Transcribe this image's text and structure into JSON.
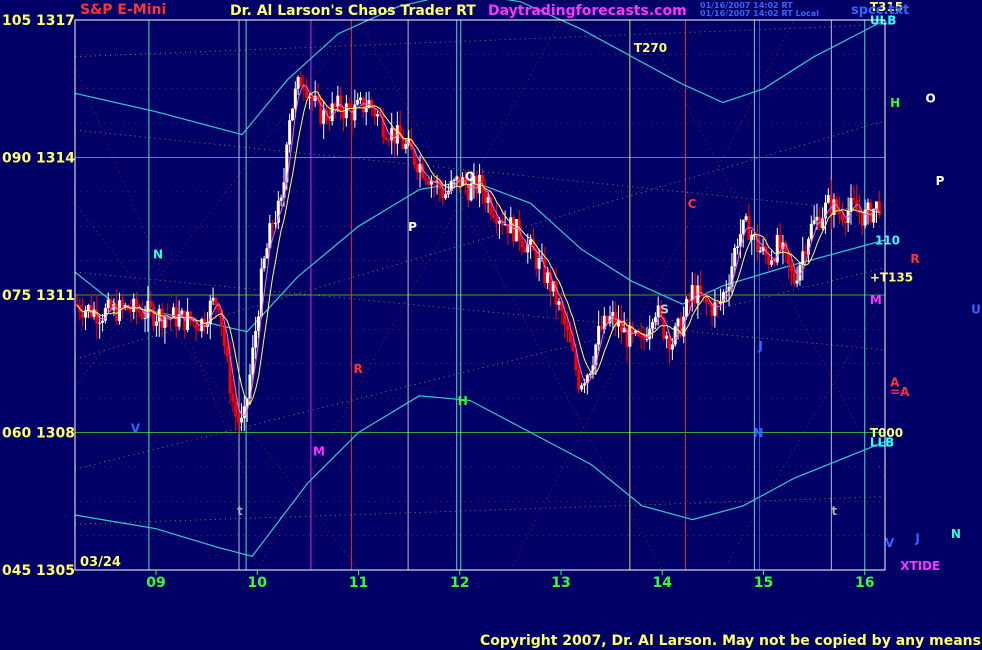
{
  "header": {
    "symbol": "S&P E-Mini",
    "title": "Dr. Al Larson's Chaos Trader RT",
    "website": "Daytradingforecasts.com",
    "stamp_line1": "01/16/2007 14:02 RT",
    "stamp_line2": "01/16/2007 14:02 RT Local",
    "file": "spcc.txt"
  },
  "footer": {
    "copyright": "Copyright 2007, Dr. Al Larson.  May not be copied by any means."
  },
  "colors": {
    "background": "#000066",
    "frame": "#ffffff",
    "up_bar": "#ffffff",
    "down_bar": "#ff0000",
    "envelope": "#33cccc",
    "grid_green": "#33aa33",
    "yellow_text": "#ffff00",
    "red_text": "#ff0000",
    "magenta_text": "#ff33ff",
    "green_text": "#33ff33",
    "cyan_text": "#33ffff"
  },
  "chart_data": {
    "type": "candlestick",
    "date_label": "03/24",
    "x_tick_labels": [
      "09",
      "10",
      "11",
      "12",
      "13",
      "14",
      "15",
      "16"
    ],
    "x_tick_values": [
      9,
      10,
      11,
      12,
      13,
      14,
      15,
      16
    ],
    "xlim": [
      8.2,
      16.2
    ],
    "y_ticks": [
      {
        "left": "105",
        "price": "1317",
        "value": 1317
      },
      {
        "left": "090",
        "price": "1314",
        "value": 1314
      },
      {
        "left": "075",
        "price": "1311",
        "value": 1311
      },
      {
        "left": "060",
        "price": "1308",
        "value": 1308
      },
      {
        "left": "045",
        "price": "1305",
        "value": 1305
      }
    ],
    "ylim": [
      1305,
      1317
    ],
    "vertical_lines": [
      {
        "x": 8.93,
        "color": "#66ffcc"
      },
      {
        "x": 9.82,
        "color": "#dddddd"
      },
      {
        "x": 9.89,
        "color": "#66ffcc"
      },
      {
        "x": 10.53,
        "color": "#ff33ff"
      },
      {
        "x": 10.93,
        "color": "#ff3333"
      },
      {
        "x": 11.49,
        "color": "#dddddd"
      },
      {
        "x": 11.97,
        "color": "#66ffcc"
      },
      {
        "x": 12.01,
        "color": "#66ffcc"
      },
      {
        "x": 13.68,
        "color": "#ffff66"
      },
      {
        "x": 14.23,
        "color": "#ff3333"
      },
      {
        "x": 14.91,
        "color": "#66ffcc"
      },
      {
        "x": 14.96,
        "color": "#3366ff"
      },
      {
        "x": 15.67,
        "color": "#dddddd"
      },
      {
        "x": 16.0,
        "color": "#66ffcc"
      }
    ],
    "horizontal_levels": [
      {
        "y": 1314,
        "color": "#33aa33"
      },
      {
        "y": 1311,
        "color": "#33aa33"
      },
      {
        "y": 1308,
        "color": "#33aa33"
      }
    ],
    "close_series": [
      [
        8.2,
        1310.8
      ],
      [
        8.45,
        1310.6
      ],
      [
        8.7,
        1310.7
      ],
      [
        8.95,
        1310.6
      ],
      [
        9.2,
        1310.5
      ],
      [
        9.45,
        1310.4
      ],
      [
        9.55,
        1310.8
      ],
      [
        9.62,
        1310.9
      ],
      [
        9.7,
        1309.5
      ],
      [
        9.78,
        1308.4
      ],
      [
        9.86,
        1308.1
      ],
      [
        9.95,
        1309.6
      ],
      [
        10.05,
        1311.5
      ],
      [
        10.15,
        1312.6
      ],
      [
        10.25,
        1313.0
      ],
      [
        10.3,
        1314.8
      ],
      [
        10.38,
        1315.4
      ],
      [
        10.45,
        1315.8
      ],
      [
        10.55,
        1315.2
      ],
      [
        10.65,
        1314.9
      ],
      [
        10.8,
        1315.1
      ],
      [
        10.95,
        1315.0
      ],
      [
        11.1,
        1315.2
      ],
      [
        11.25,
        1314.7
      ],
      [
        11.4,
        1314.4
      ],
      [
        11.55,
        1314.0
      ],
      [
        11.7,
        1313.6
      ],
      [
        11.85,
        1313.2
      ],
      [
        12.0,
        1313.5
      ],
      [
        12.1,
        1313.3
      ],
      [
        12.2,
        1313.4
      ],
      [
        12.3,
        1313.0
      ],
      [
        12.45,
        1312.6
      ],
      [
        12.6,
        1312.3
      ],
      [
        12.75,
        1311.8
      ],
      [
        12.9,
        1311.2
      ],
      [
        13.0,
        1310.6
      ],
      [
        13.1,
        1309.8
      ],
      [
        13.18,
        1309.1
      ],
      [
        13.28,
        1309.4
      ],
      [
        13.38,
        1310.2
      ],
      [
        13.5,
        1310.5
      ],
      [
        13.65,
        1310.1
      ],
      [
        13.8,
        1309.9
      ],
      [
        13.92,
        1310.8
      ],
      [
        14.0,
        1310.3
      ],
      [
        14.1,
        1310.0
      ],
      [
        14.2,
        1310.4
      ],
      [
        14.3,
        1311.1
      ],
      [
        14.42,
        1310.8
      ],
      [
        14.55,
        1310.7
      ],
      [
        14.65,
        1311.3
      ],
      [
        14.75,
        1312.3
      ],
      [
        14.85,
        1312.5
      ],
      [
        14.95,
        1312.0
      ],
      [
        15.05,
        1311.8
      ],
      [
        15.15,
        1312.1
      ],
      [
        15.3,
        1311.3
      ],
      [
        15.45,
        1312.4
      ],
      [
        15.55,
        1312.7
      ],
      [
        15.65,
        1313.0
      ],
      [
        15.75,
        1312.8
      ],
      [
        15.9,
        1312.9
      ],
      [
        16.0,
        1312.7
      ],
      [
        16.15,
        1313.0
      ]
    ],
    "envelopes": {
      "upper": [
        [
          8.2,
          1315.4
        ],
        [
          9.0,
          1315.0
        ],
        [
          9.85,
          1314.5
        ],
        [
          10.3,
          1315.7
        ],
        [
          10.8,
          1316.7
        ],
        [
          11.4,
          1317.3
        ],
        [
          12.0,
          1317.6
        ],
        [
          12.6,
          1317.4
        ],
        [
          13.2,
          1316.8
        ],
        [
          13.7,
          1316.2
        ],
        [
          14.2,
          1315.6
        ],
        [
          14.6,
          1315.2
        ],
        [
          15.0,
          1315.5
        ],
        [
          15.5,
          1316.2
        ],
        [
          16.2,
          1317.0
        ]
      ],
      "middle": [
        [
          8.2,
          1311.5
        ],
        [
          8.6,
          1310.8
        ],
        [
          9.3,
          1310.5
        ],
        [
          9.9,
          1310.2
        ],
        [
          10.4,
          1311.4
        ],
        [
          11.0,
          1312.5
        ],
        [
          11.6,
          1313.3
        ],
        [
          12.1,
          1313.5
        ],
        [
          12.7,
          1313.0
        ],
        [
          13.2,
          1312.0
        ],
        [
          13.7,
          1311.3
        ],
        [
          14.2,
          1310.8
        ],
        [
          14.6,
          1311.2
        ],
        [
          15.2,
          1311.6
        ],
        [
          16.2,
          1312.2
        ]
      ],
      "lower": [
        [
          8.2,
          1306.2
        ],
        [
          9.0,
          1305.9
        ],
        [
          9.6,
          1305.5
        ],
        [
          9.95,
          1305.3
        ],
        [
          10.5,
          1306.9
        ],
        [
          11.0,
          1308.0
        ],
        [
          11.6,
          1308.8
        ],
        [
          12.1,
          1308.7
        ],
        [
          12.7,
          1308.0
        ],
        [
          13.3,
          1307.3
        ],
        [
          13.8,
          1306.4
        ],
        [
          14.3,
          1306.1
        ],
        [
          14.8,
          1306.4
        ],
        [
          15.3,
          1307.0
        ],
        [
          16.2,
          1307.8
        ]
      ]
    },
    "annotations": [
      {
        "text": "T270",
        "x": 13.72,
        "y": 1316.3,
        "color": "#ffff66"
      },
      {
        "text": "T315",
        "x": 16.05,
        "y": 1317.2,
        "color": "#ffff66"
      },
      {
        "text": "ULB",
        "x": 16.05,
        "y": 1316.9,
        "color": "#33ffff"
      },
      {
        "text": "H",
        "x": 16.25,
        "y": 1315.1,
        "color": "#33ff33"
      },
      {
        "text": "O",
        "x": 16.6,
        "y": 1315.2,
        "color": "#ffffff"
      },
      {
        "text": "P",
        "x": 16.7,
        "y": 1313.4,
        "color": "#ffffff"
      },
      {
        "text": "110",
        "x": 16.1,
        "y": 1312.1,
        "color": "#33ffff"
      },
      {
        "text": "R",
        "x": 16.45,
        "y": 1311.7,
        "color": "#ff3333"
      },
      {
        "text": "+T135",
        "x": 16.05,
        "y": 1311.3,
        "color": "#ffff66"
      },
      {
        "text": "M",
        "x": 16.05,
        "y": 1310.8,
        "color": "#ff33ff"
      },
      {
        "text": "U",
        "x": 17.05,
        "y": 1310.6,
        "color": "#3366ff"
      },
      {
        "text": "A",
        "x": 16.25,
        "y": 1309.0,
        "color": "#ff3333"
      },
      {
        "text": "=A",
        "x": 16.25,
        "y": 1308.8,
        "color": "#ff3333"
      },
      {
        "text": "T000",
        "x": 16.05,
        "y": 1307.9,
        "color": "#ffff66"
      },
      {
        "text": "LLB",
        "x": 16.05,
        "y": 1307.7,
        "color": "#33ffff"
      },
      {
        "text": "V",
        "x": 16.2,
        "y": 1305.5,
        "color": "#3366ff"
      },
      {
        "text": "J",
        "x": 16.5,
        "y": 1305.6,
        "color": "#3366ff"
      },
      {
        "text": "N",
        "x": 16.85,
        "y": 1305.7,
        "color": "#33ffcc"
      },
      {
        "text": "XTIDE",
        "x": 16.35,
        "y": 1305.0,
        "color": "#ff33ff"
      },
      {
        "text": "N",
        "x": 8.97,
        "y": 1311.8,
        "color": "#33ffcc"
      },
      {
        "text": "V",
        "x": 8.75,
        "y": 1308.0,
        "color": "#3366ff"
      },
      {
        "text": "t",
        "x": 9.8,
        "y": 1306.2,
        "color": "#aaaaaa"
      },
      {
        "text": "M",
        "x": 10.55,
        "y": 1307.5,
        "color": "#ff33ff"
      },
      {
        "text": "R",
        "x": 10.95,
        "y": 1309.3,
        "color": "#ff3333"
      },
      {
        "text": "P",
        "x": 11.49,
        "y": 1312.4,
        "color": "#ffffff"
      },
      {
        "text": "O",
        "x": 12.05,
        "y": 1313.5,
        "color": "#ffffff"
      },
      {
        "text": "H",
        "x": 11.98,
        "y": 1308.6,
        "color": "#33ff33"
      },
      {
        "text": "S",
        "x": 13.98,
        "y": 1310.6,
        "color": "#cccccc"
      },
      {
        "text": "C",
        "x": 14.25,
        "y": 1312.9,
        "color": "#ff3333"
      },
      {
        "text": "N",
        "x": 14.9,
        "y": 1307.9,
        "color": "#3366ff"
      },
      {
        "text": "J",
        "x": 14.95,
        "y": 1309.8,
        "color": "#3366ff"
      },
      {
        "text": "t",
        "x": 15.67,
        "y": 1306.2,
        "color": "#aaaaaa"
      }
    ]
  }
}
